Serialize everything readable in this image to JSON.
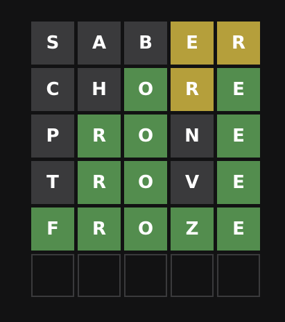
{
  "colors": {
    "background": "#121213",
    "absent": "#3a3a3c",
    "present": "#b59f3b",
    "correct": "#538d4e",
    "empty_border": "#3a3a3c",
    "text": "#ffffff"
  },
  "board": {
    "rows": [
      {
        "word": "SABER",
        "tiles": [
          {
            "letter": "S",
            "state": "absent"
          },
          {
            "letter": "A",
            "state": "absent"
          },
          {
            "letter": "B",
            "state": "absent"
          },
          {
            "letter": "E",
            "state": "present"
          },
          {
            "letter": "R",
            "state": "present"
          }
        ]
      },
      {
        "word": "CHORE",
        "tiles": [
          {
            "letter": "C",
            "state": "absent"
          },
          {
            "letter": "H",
            "state": "absent"
          },
          {
            "letter": "O",
            "state": "correct"
          },
          {
            "letter": "R",
            "state": "present"
          },
          {
            "letter": "E",
            "state": "correct"
          }
        ]
      },
      {
        "word": "PRONE",
        "tiles": [
          {
            "letter": "P",
            "state": "absent"
          },
          {
            "letter": "R",
            "state": "correct"
          },
          {
            "letter": "O",
            "state": "correct"
          },
          {
            "letter": "N",
            "state": "absent"
          },
          {
            "letter": "E",
            "state": "correct"
          }
        ]
      },
      {
        "word": "TROVE",
        "tiles": [
          {
            "letter": "T",
            "state": "absent"
          },
          {
            "letter": "R",
            "state": "correct"
          },
          {
            "letter": "O",
            "state": "correct"
          },
          {
            "letter": "V",
            "state": "absent"
          },
          {
            "letter": "E",
            "state": "correct"
          }
        ]
      },
      {
        "word": "FROZE",
        "tiles": [
          {
            "letter": "F",
            "state": "correct"
          },
          {
            "letter": "R",
            "state": "correct"
          },
          {
            "letter": "O",
            "state": "correct"
          },
          {
            "letter": "Z",
            "state": "correct"
          },
          {
            "letter": "E",
            "state": "correct"
          }
        ]
      },
      {
        "word": "",
        "tiles": [
          {
            "letter": "",
            "state": "empty"
          },
          {
            "letter": "",
            "state": "empty"
          },
          {
            "letter": "",
            "state": "empty"
          },
          {
            "letter": "",
            "state": "empty"
          },
          {
            "letter": "",
            "state": "empty"
          }
        ]
      }
    ]
  }
}
